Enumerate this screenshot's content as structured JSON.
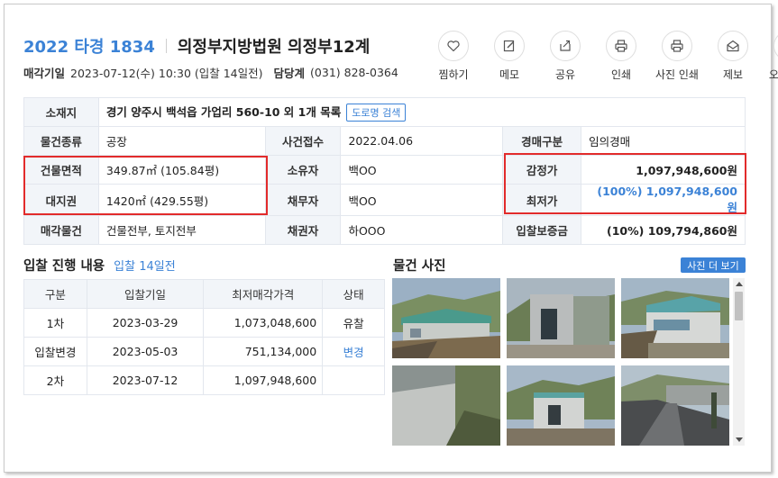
{
  "header": {
    "case_no": "2022 타경 1834",
    "court": "의정부지방법원 의정부12계",
    "sale_date_label": "매각기일",
    "sale_date_value": "2023-07-12(수) 10:30 (입찰 14일전)",
    "contact_label": "담당계",
    "contact_value": "(031) 828-0364"
  },
  "actions": [
    {
      "label": "찜하기",
      "icon": "heart-icon"
    },
    {
      "label": "메모",
      "icon": "pencil-icon"
    },
    {
      "label": "공유",
      "icon": "share-icon"
    },
    {
      "label": "인쇄",
      "icon": "printer-icon"
    },
    {
      "label": "사진 인쇄",
      "icon": "printer-icon"
    },
    {
      "label": "제보",
      "icon": "envelope-icon"
    },
    {
      "label": "오류신고",
      "icon": "ghost-icon"
    }
  ],
  "details": {
    "location_label": "소재지",
    "location_value": "경기 양주시 백석읍 가업리 560-10 외 1개 목록",
    "road_btn": "도로명 검색",
    "type_label": "물건종류",
    "type_value": "공장",
    "received_label": "사건접수",
    "received_value": "2022.04.06",
    "auction_type_label": "경매구분",
    "auction_type_value": "임의경매",
    "building_area_label": "건물면적",
    "building_area_value": "349.87㎡ (105.84평)",
    "owner_label": "소유자",
    "owner_value": "백OO",
    "appraisal_label": "감정가",
    "appraisal_value": "1,097,948,600원",
    "land_label": "대지권",
    "land_value": "1420㎡ (429.55평)",
    "debtor_label": "채무자",
    "debtor_value": "백OO",
    "min_price_label": "최저가",
    "min_price_value": "(100%) 1,097,948,600원",
    "sale_items_label": "매각물건",
    "sale_items_value": "건물전부, 토지전부",
    "creditor_label": "채권자",
    "creditor_value": "하OOO",
    "deposit_label": "입찰보증금",
    "deposit_value": "(10%) 109,794,860원"
  },
  "bidding": {
    "title": "입찰 진행 내용",
    "subtitle": "입찰 14일전",
    "headers": [
      "구분",
      "입찰기일",
      "최저매각가격",
      "상태"
    ],
    "rows": [
      {
        "round": "1차",
        "date": "2023-03-29",
        "price": "1,073,048,600",
        "status": "유찰"
      },
      {
        "round": "입찰변경",
        "date": "2023-05-03",
        "price": "751,134,000",
        "status": "변경"
      },
      {
        "round": "2차",
        "date": "2023-07-12",
        "price": "1,097,948,600",
        "status": ""
      }
    ]
  },
  "photos": {
    "title": "물건 사진",
    "more_btn": "사진 더 보기"
  },
  "colors": {
    "accent": "#3b82d6",
    "highlight_box": "#e22b2b",
    "table_header_bg": "#f2f5f9"
  }
}
